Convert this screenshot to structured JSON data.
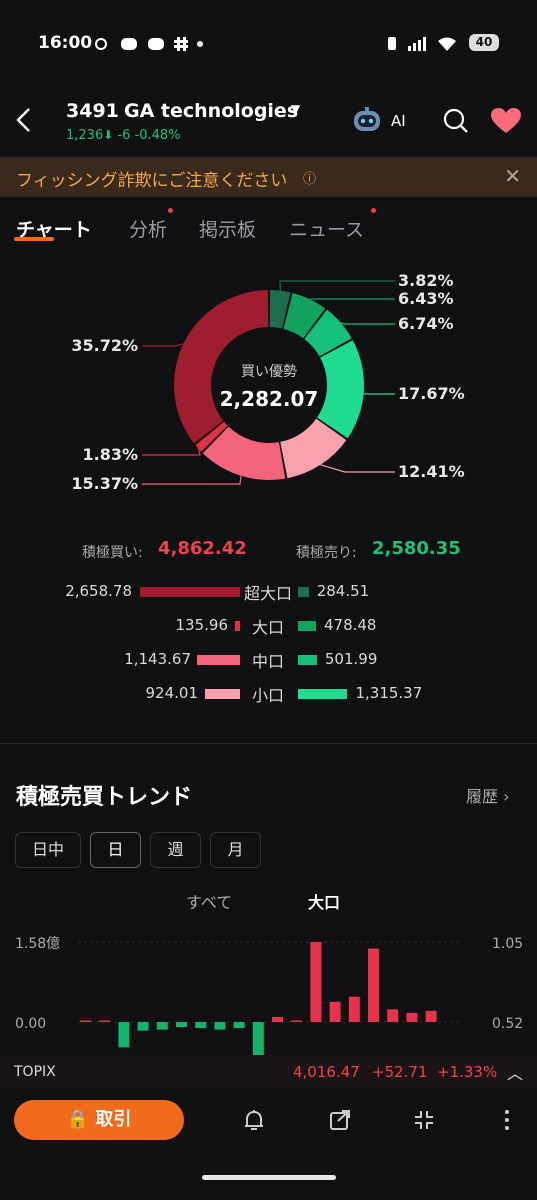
{
  "status_bar": {
    "time": "16:00",
    "icons": [
      "bike-icon",
      "discord-icon",
      "discord-icon",
      "slack-icon",
      "dot-icon",
      "vibrate-icon",
      "signal-icon",
      "wifi-icon"
    ],
    "battery": "40"
  },
  "header": {
    "code": "3491",
    "name": "GA technologies",
    "price": "1,236",
    "change": "-6",
    "change_pct": "-0.48%",
    "ai_label": "AI"
  },
  "banner": {
    "text": "フィッシング詐欺にご注意ください",
    "info": "ⓘ"
  },
  "tabs": [
    {
      "label": "チャート",
      "active": true
    },
    {
      "label": "分析",
      "dot": true
    },
    {
      "label": "掲示板"
    },
    {
      "label": "ニュース",
      "dot": true
    }
  ],
  "donut": {
    "center_label": "買い優勢",
    "center_value": "2,282.07",
    "segments": [
      {
        "label": "3.82%",
        "value": 3.82,
        "color": "#1c6e4c"
      },
      {
        "label": "6.43%",
        "value": 6.43,
        "color": "#12a35e"
      },
      {
        "label": "6.74%",
        "value": 6.74,
        "color": "#14c07c"
      },
      {
        "label": "17.67%",
        "value": 17.67,
        "color": "#1fdc92"
      },
      {
        "label": "12.41%",
        "value": 12.41,
        "color": "#f7a1ad"
      },
      {
        "label": "15.37%",
        "value": 15.37,
        "color": "#f2657a"
      },
      {
        "label": "1.83%",
        "value": 1.83,
        "color": "#e03243"
      },
      {
        "label": "35.72%",
        "value": 35.72,
        "color": "#9e1d2e"
      }
    ]
  },
  "totals": {
    "buy_label": "積極買い:",
    "buy_value": "4,862.42",
    "sell_label": "積極売り:",
    "sell_value": "2,580.35"
  },
  "flow_rows": [
    {
      "label": "超大口",
      "buy": "2,658.78",
      "sell": "284.51",
      "buy_color": "#9e1d2e",
      "sell_color": "#1c6e4c",
      "buy_num": 2658.78,
      "sell_num": 284.51
    },
    {
      "label": "大口",
      "buy": "135.96",
      "sell": "478.48",
      "buy_color": "#e03243",
      "sell_color": "#12a35e",
      "buy_num": 135.96,
      "sell_num": 478.48
    },
    {
      "label": "中口",
      "buy": "1,143.67",
      "sell": "501.99",
      "buy_color": "#f2657a",
      "sell_color": "#14c07c",
      "buy_num": 1143.67,
      "sell_num": 501.99
    },
    {
      "label": "小口",
      "buy": "924.01",
      "sell": "1,315.37",
      "buy_color": "#f7a1ad",
      "sell_color": "#1fdc92",
      "buy_num": 924.01,
      "sell_num": 1315.37
    }
  ],
  "trend": {
    "title": "積極売買トレンド",
    "history": "履歴",
    "periods": [
      {
        "label": "日中"
      },
      {
        "label": "日",
        "active": true
      },
      {
        "label": "週"
      },
      {
        "label": "月"
      }
    ],
    "filter_all": "すべて",
    "filter_large": "大口"
  },
  "chart_data": {
    "type": "bar",
    "yaxis_left": [
      "1.58億",
      "0.00"
    ],
    "yaxis_right": [
      "1.05",
      "0.52"
    ],
    "values": [
      0.01,
      0,
      -0.5,
      -0.17,
      -0.15,
      -0.1,
      -0.12,
      -0.15,
      -0.12,
      -0.95,
      0.1,
      0,
      1.58,
      0.4,
      0.5,
      1.45,
      0.25,
      0.18,
      0.22
    ]
  },
  "ticker": {
    "name": "TOPIX",
    "price": "4,016.47",
    "change": "+52.71",
    "change_pct": "+1.33%"
  },
  "toolbar": {
    "trade_label": "取引"
  }
}
